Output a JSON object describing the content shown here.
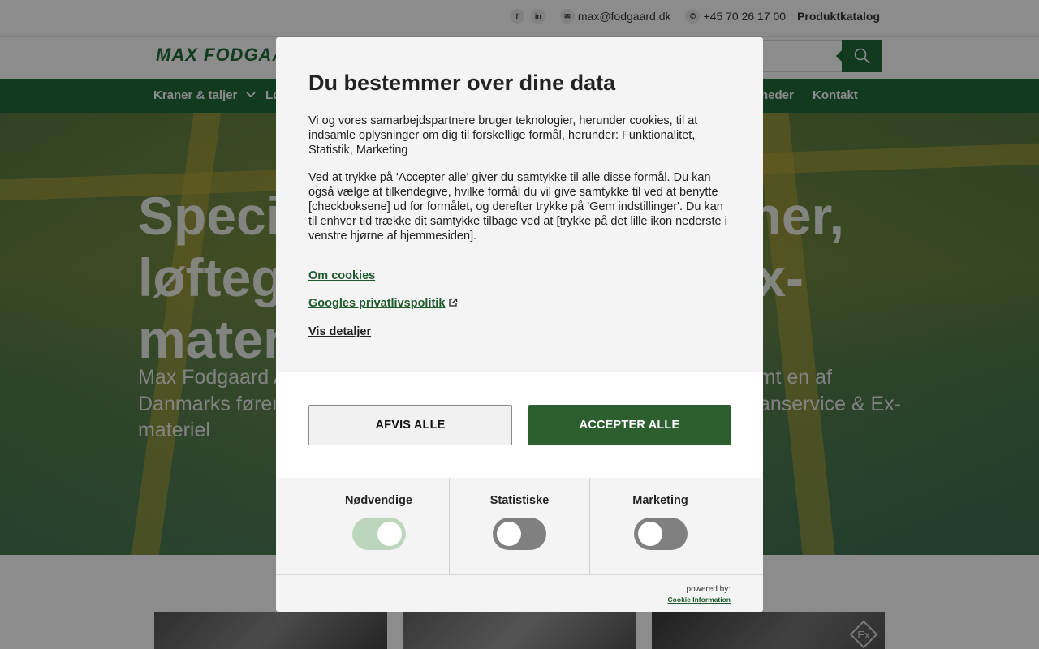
{
  "topbar": {
    "facebook_icon": "f",
    "linkedin_icon": "in",
    "email": "max@fodgaard.dk",
    "phone": "+45 70 26 17 00",
    "catalog": "Produktkatalog"
  },
  "header": {
    "logo_text": "MAX FODGAARD",
    "search_placeholder": ""
  },
  "nav": {
    "items": [
      "Kraner & taljer",
      "Lø",
      "heder",
      "Kontakt"
    ]
  },
  "hero": {
    "title": "Speci                                    ner, løfteg                                  x- mater",
    "title_left": "Speci",
    "title_right": "ner,",
    "title_l2_left": "løfteg",
    "title_l2_right": "x-",
    "title_l3_left": "mater",
    "sub_l1_left": "Max Fodgaard A",
    "sub_l1_right": "samt en af",
    "sub_l2_left": "Danmarks føren",
    "sub_l2_right": "anservice & Ex-",
    "sub_l3_left": "materiel"
  },
  "dialog": {
    "title": "Du bestemmer over dine data",
    "para1": "Vi og vores samarbejdspartnere bruger teknologier, herunder cookies, til at indsamle oplysninger om dig til forskellige formål, herunder: Funktionalitet, Statistik, Marketing",
    "para2": "Ved at trykke på 'Accepter alle' giver du samtykke til alle disse formål. Du kan også vælge at tilkendegive, hvilke formål du vil give samtykke til ved at benytte [checkboksene] ud for formålet, og derefter trykke på 'Gem indstillinger'. Du kan til enhver tid trække dit samtykke tilbage ved at [trykke på det lille ikon nederste i venstre hjørne af hjemmesiden].",
    "link_cookies": "Om cookies",
    "link_google": "Googles privatlivspolitik",
    "link_details": "Vis detaljer",
    "reject_label": "AFVIS ALLE",
    "accept_label": "ACCEPTER ALLE",
    "toggles": [
      {
        "label": "Nødvendige",
        "state": "on-disabled"
      },
      {
        "label": "Statistiske",
        "state": "off"
      },
      {
        "label": "Marketing",
        "state": "off"
      }
    ],
    "powered_by": "powered by:",
    "powered_link": "Cookie Information"
  },
  "colors": {
    "brand_green": "#1f6b3a",
    "accept_green": "#2c5e2e",
    "link_green": "#1f5a2e"
  }
}
